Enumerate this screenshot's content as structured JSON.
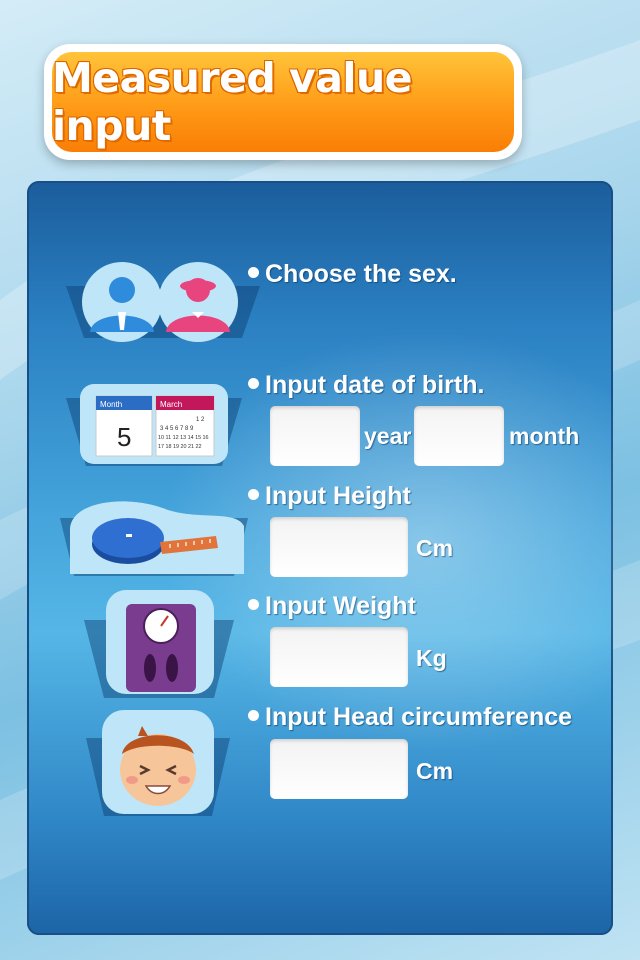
{
  "header": {
    "title": "Measured value input"
  },
  "sex": {
    "label": "Choose the sex."
  },
  "birth": {
    "label": "Input date of birth.",
    "year_value": "",
    "year_unit": "year",
    "month_value": "",
    "month_unit": "month",
    "calendar_left_header": "Month",
    "calendar_left_number": "5",
    "calendar_right_header": "March",
    "calendar_right_rows": [
      "1 2",
      "3 4 5 6 7 8 9",
      "10 11 12 13 14 15 16",
      "17 18 19 20 21 22"
    ]
  },
  "height": {
    "label": "Input Height",
    "value": "",
    "unit": "Cm"
  },
  "weight": {
    "label": "Input Weight",
    "value": "",
    "unit": "Kg"
  },
  "head": {
    "label": "Input Head circumference",
    "value": "",
    "unit": "Cm"
  },
  "colors": {
    "accent_orange": "#ff9a16",
    "panel_blue": "#2a7fc1",
    "male_blue": "#2f8bdb",
    "female_pink": "#e8457e",
    "scale_purple": "#7a3c8e"
  },
  "icons": {
    "sex": "male-female-icon",
    "birth": "calendar-icon",
    "height": "tape-measure-icon",
    "weight": "scale-icon",
    "head": "baby-face-icon"
  }
}
